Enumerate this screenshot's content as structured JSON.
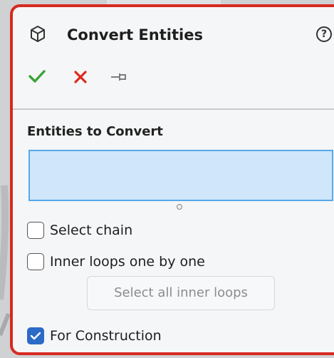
{
  "panel": {
    "title": "Convert Entities",
    "help": "?",
    "colors": {
      "border": "#d72a20",
      "ok": "#3aa336",
      "cancel": "#e0281f",
      "selection_fill": "#cfe6fb",
      "selection_border": "#56a9ea",
      "check_fill": "#2c6ac8"
    }
  },
  "section": {
    "title": "Entities to Convert"
  },
  "options": {
    "select_chain": {
      "label": "Select chain",
      "checked": false
    },
    "inner_loops": {
      "label": "Inner loops one by one",
      "checked": false
    },
    "select_all_inner_loops": {
      "label": "Select all inner loops",
      "enabled": false
    },
    "for_construction": {
      "label": "For Construction",
      "checked": true
    }
  }
}
